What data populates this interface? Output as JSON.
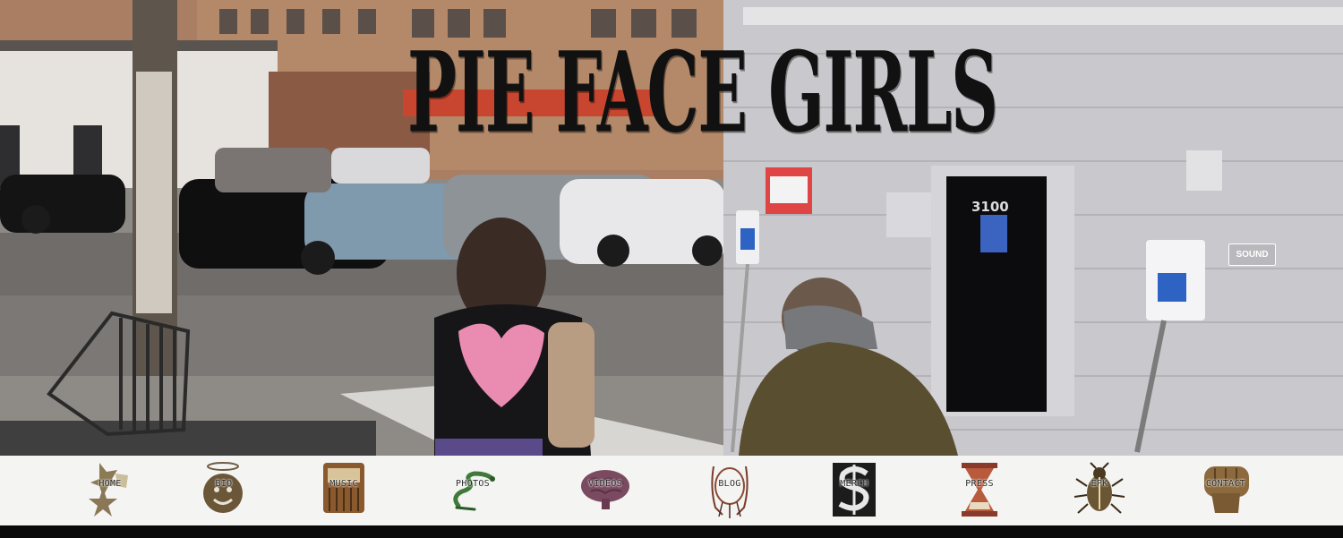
{
  "site": {
    "title": "PIE FACE GIRLS"
  },
  "controls": {
    "sound_label": "SOUND"
  },
  "scene": {
    "door_number": "3100"
  },
  "nav": {
    "items": [
      {
        "label": "HOME",
        "icon": "sheriff-star-icon"
      },
      {
        "label": "BIO",
        "icon": "halo-face-icon"
      },
      {
        "label": "MUSIC",
        "icon": "jukebox-icon"
      },
      {
        "label": "PHOTOS",
        "icon": "snake-icon"
      },
      {
        "label": "VIDEOS",
        "icon": "brain-icon"
      },
      {
        "label": "BLOG",
        "icon": "sketch-face-icon"
      },
      {
        "label": "MERCH",
        "icon": "dollar-sign-icon"
      },
      {
        "label": "PRESS",
        "icon": "hourglass-icon"
      },
      {
        "label": "EPK",
        "icon": "beetle-icon"
      },
      {
        "label": "CONTACT",
        "icon": "fist-icon"
      }
    ]
  },
  "colors": {
    "nav_background": "#f4f4f2",
    "title": "#111111",
    "sound_border": "#ffffff"
  }
}
